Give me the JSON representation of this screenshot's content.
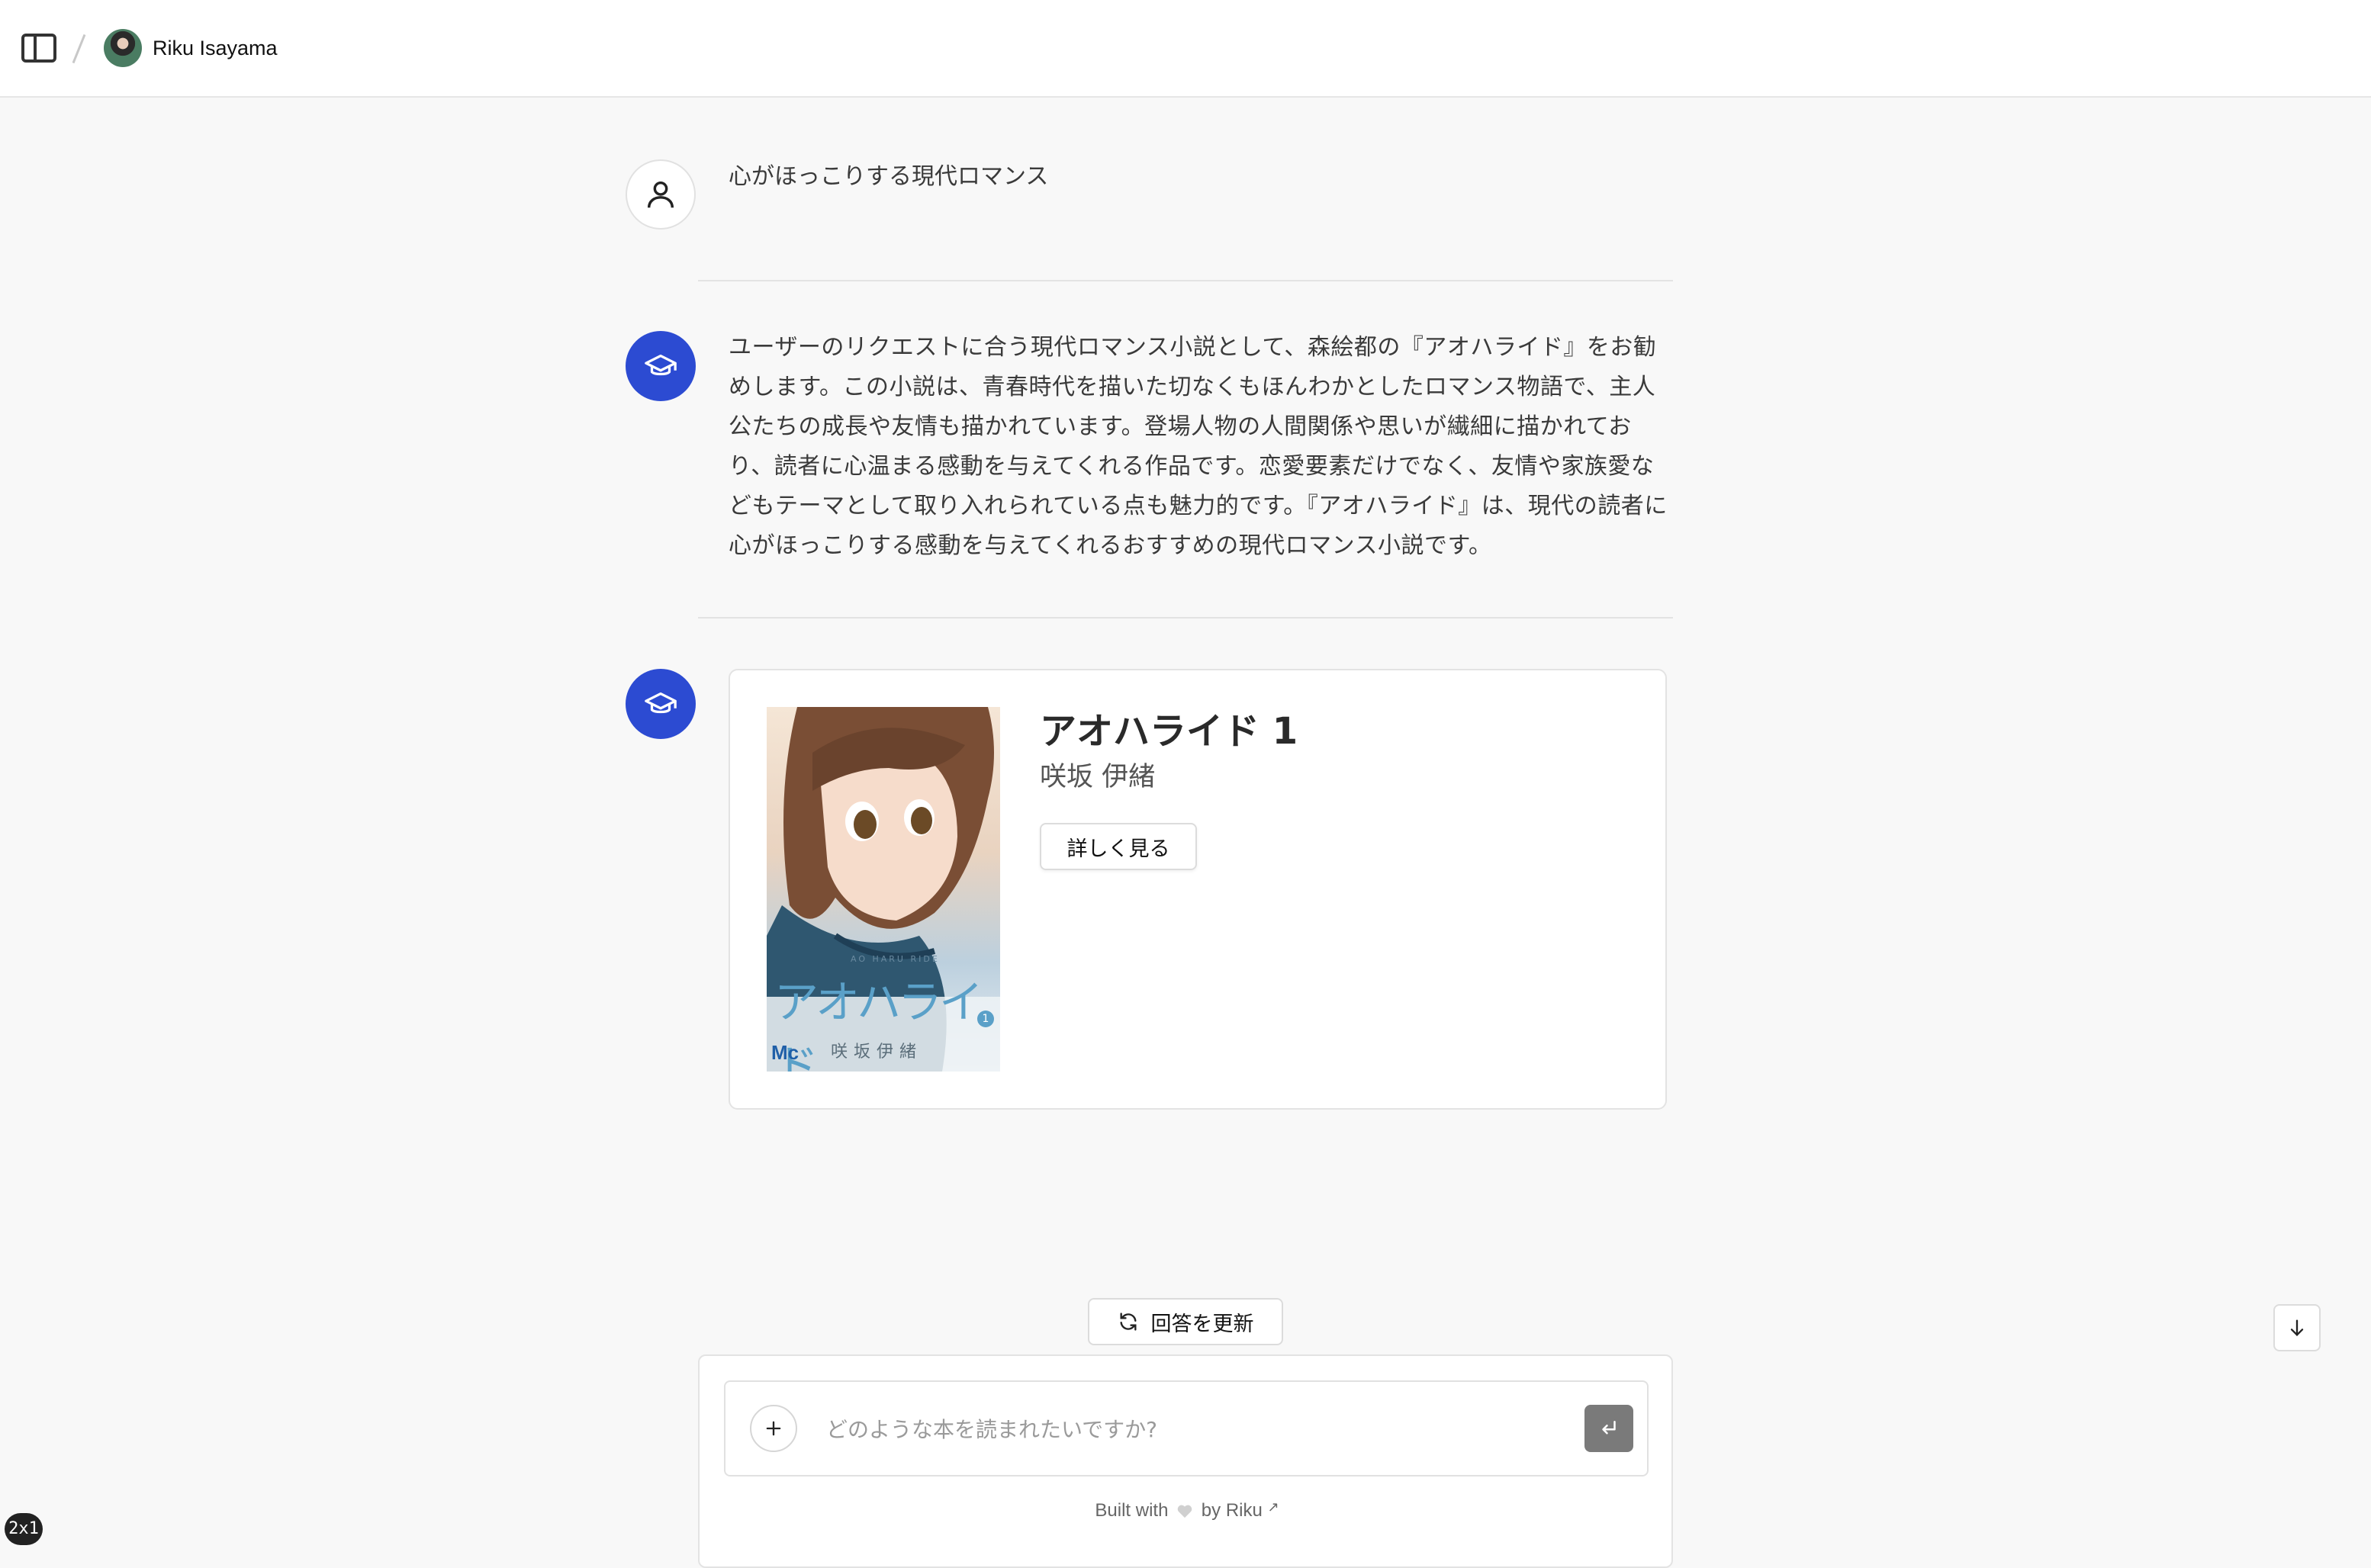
{
  "header": {
    "user_name": "Riku Isayama"
  },
  "conversation": {
    "user_message": "心がほっこりする現代ロマンス",
    "assistant_message": "ユーザーのリクエストに合う現代ロマンス小説として、森絵都の『アオハライド』をお勧めします。この小説は、青春時代を描いた切なくもほんわかとしたロマンス物語で、主人公たちの成長や友情も描かれています。登場人物の人間関係や思いが繊細に描かれており、読者に心温まる感動を与えてくれる作品です。恋愛要素だけでなく、友情や家族愛などもテーマとして取り入れられている点も魅力的です。『アオハライド』は、現代の読者に心がほっこりする感動を与えてくれるおすすめの現代ロマンス小説です。"
  },
  "book": {
    "title": "アオハライド 1",
    "author": "咲坂 伊緒",
    "details_label": "詳しく見る",
    "cover": {
      "logo_text": "アオハライド",
      "subtitle_text": "AO HARU RIDE",
      "volume": "1",
      "author_text": "咲坂伊緒",
      "publisher_mark": "Mc"
    }
  },
  "actions": {
    "regenerate_label": "回答を更新"
  },
  "composer": {
    "placeholder": "どのような本を読まれたいですか?"
  },
  "footer": {
    "built_with": "Built with",
    "by": "by Riku",
    "external_mark": "↗"
  },
  "badge": {
    "label": "2x1"
  },
  "colors": {
    "accent": "#2c4bd2",
    "send_button": "#7a7a7a"
  },
  "icons": {
    "sidebar_toggle": "sidebar-toggle-icon",
    "user": "user-icon",
    "assistant": "graduation-cap-icon",
    "regenerate": "refresh-icon",
    "scroll": "arrow-down-icon",
    "add": "plus-icon",
    "send": "enter-icon",
    "heart": "heart-icon"
  }
}
